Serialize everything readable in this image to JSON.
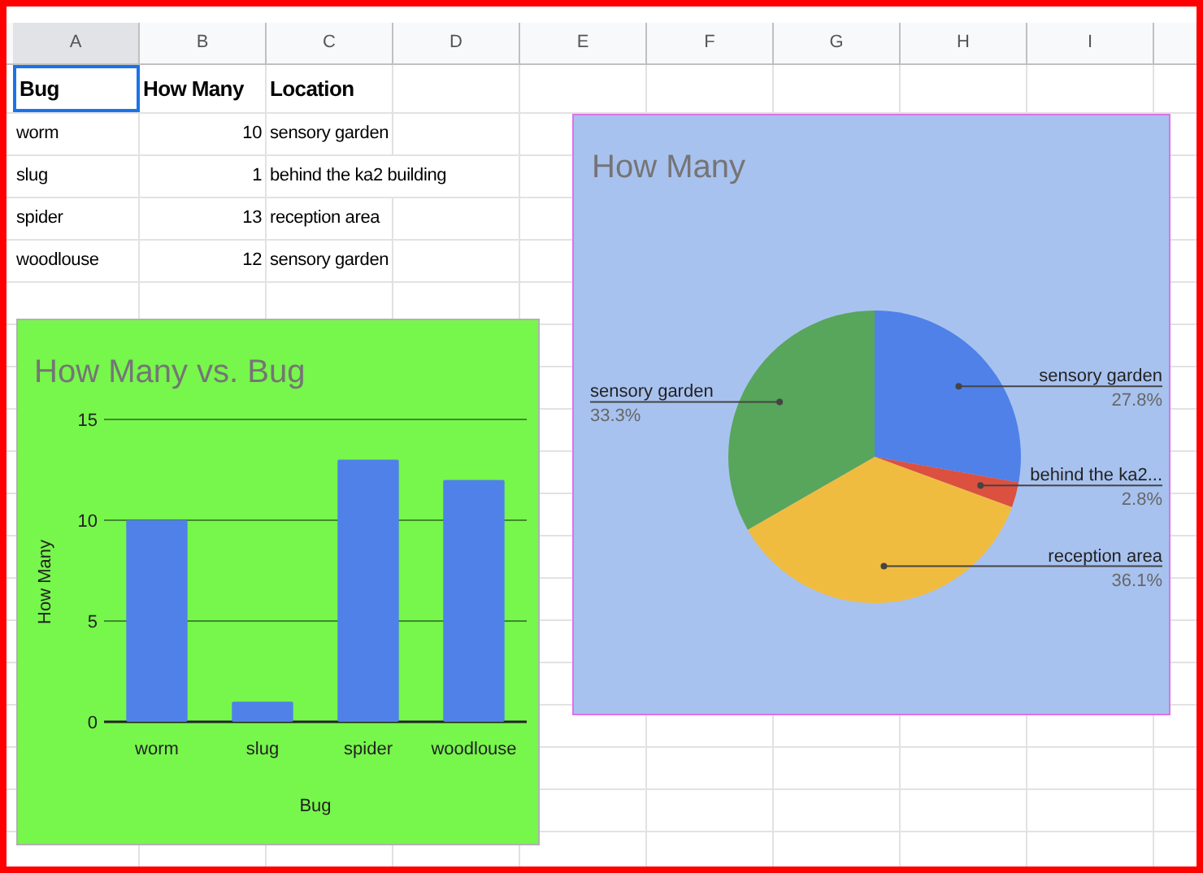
{
  "columns": [
    {
      "label": "A",
      "selected": true
    },
    {
      "label": "B",
      "selected": false
    },
    {
      "label": "C",
      "selected": false
    },
    {
      "label": "D",
      "selected": false
    },
    {
      "label": "E",
      "selected": false
    },
    {
      "label": "F",
      "selected": false
    },
    {
      "label": "G",
      "selected": false
    },
    {
      "label": "H",
      "selected": false
    },
    {
      "label": "I",
      "selected": false
    }
  ],
  "rows": [
    {
      "kind": "header",
      "cells": [
        {
          "text": "Bug",
          "selected": true
        },
        {
          "text": "How Many",
          "selected": false
        },
        {
          "text": "Location",
          "selected": false
        }
      ]
    },
    {
      "kind": "data",
      "cells": [
        {
          "text": "worm",
          "selected": false
        },
        {
          "text": "10",
          "selected": false
        },
        {
          "text": "sensory garden",
          "selected": false
        }
      ]
    },
    {
      "kind": "data",
      "cells": [
        {
          "text": "slug",
          "selected": false
        },
        {
          "text": "1",
          "selected": false
        },
        {
          "text": "behind the ka2 building",
          "selected": false
        }
      ]
    },
    {
      "kind": "data",
      "cells": [
        {
          "text": "spider",
          "selected": false
        },
        {
          "text": "13",
          "selected": false
        },
        {
          "text": "reception area",
          "selected": false
        }
      ]
    },
    {
      "kind": "data",
      "cells": [
        {
          "text": "woodlouse",
          "selected": false
        },
        {
          "text": "12",
          "selected": false
        },
        {
          "text": "sensory garden",
          "selected": false
        }
      ]
    }
  ],
  "bar_chart": {
    "chart_data": {
      "type": "bar",
      "title": "How Many vs. Bug",
      "xlabel": "Bug",
      "ylabel": "How Many",
      "categories": [
        "worm",
        "slug",
        "spider",
        "woodlouse"
      ],
      "series": [
        {
          "color": "#4f81e8",
          "values": [
            10,
            1,
            13,
            12
          ]
        }
      ],
      "ylim": [
        0,
        15
      ],
      "yticks": [
        0,
        5,
        10,
        15
      ]
    }
  },
  "pie_chart": {
    "chart_data": {
      "type": "pie",
      "title": "How Many",
      "categories": [
        "sensory garden",
        "behind the ka2...",
        "reception area",
        "sensory garden"
      ],
      "values": [
        27.8,
        2.8,
        36.1,
        33.3
      ],
      "colors": [
        "#4f81e8",
        "#dc5040",
        "#f0bc40",
        "#58a55c"
      ],
      "value_labels": [
        "27.8%",
        "2.8%",
        "36.1%",
        "33.3%"
      ]
    }
  }
}
